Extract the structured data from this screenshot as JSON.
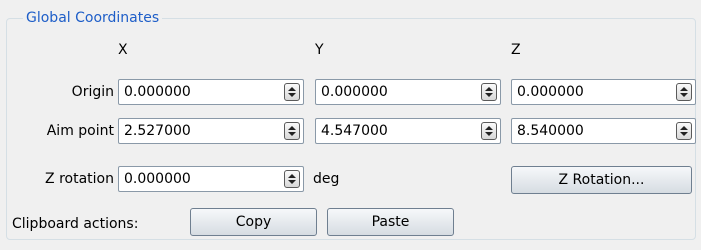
{
  "group": {
    "title": "Global Coordinates"
  },
  "columns": [
    "X",
    "Y",
    "Z"
  ],
  "rows": {
    "origin": {
      "label": "Origin",
      "x": "0.000000",
      "y": "0.000000",
      "z": "0.000000"
    },
    "aim_point": {
      "label": "Aim point",
      "x": "2.527000",
      "y": "4.547000",
      "z": "8.540000"
    },
    "z_rotation": {
      "label": "Z rotation",
      "value": "0.000000",
      "unit": "deg",
      "button_label": "Z Rotation..."
    }
  },
  "clipboard": {
    "label": "Clipboard actions:",
    "copy_label": "Copy",
    "paste_label": "Paste"
  },
  "icons": {
    "spin_arrows": "spin-up-down-icon"
  }
}
